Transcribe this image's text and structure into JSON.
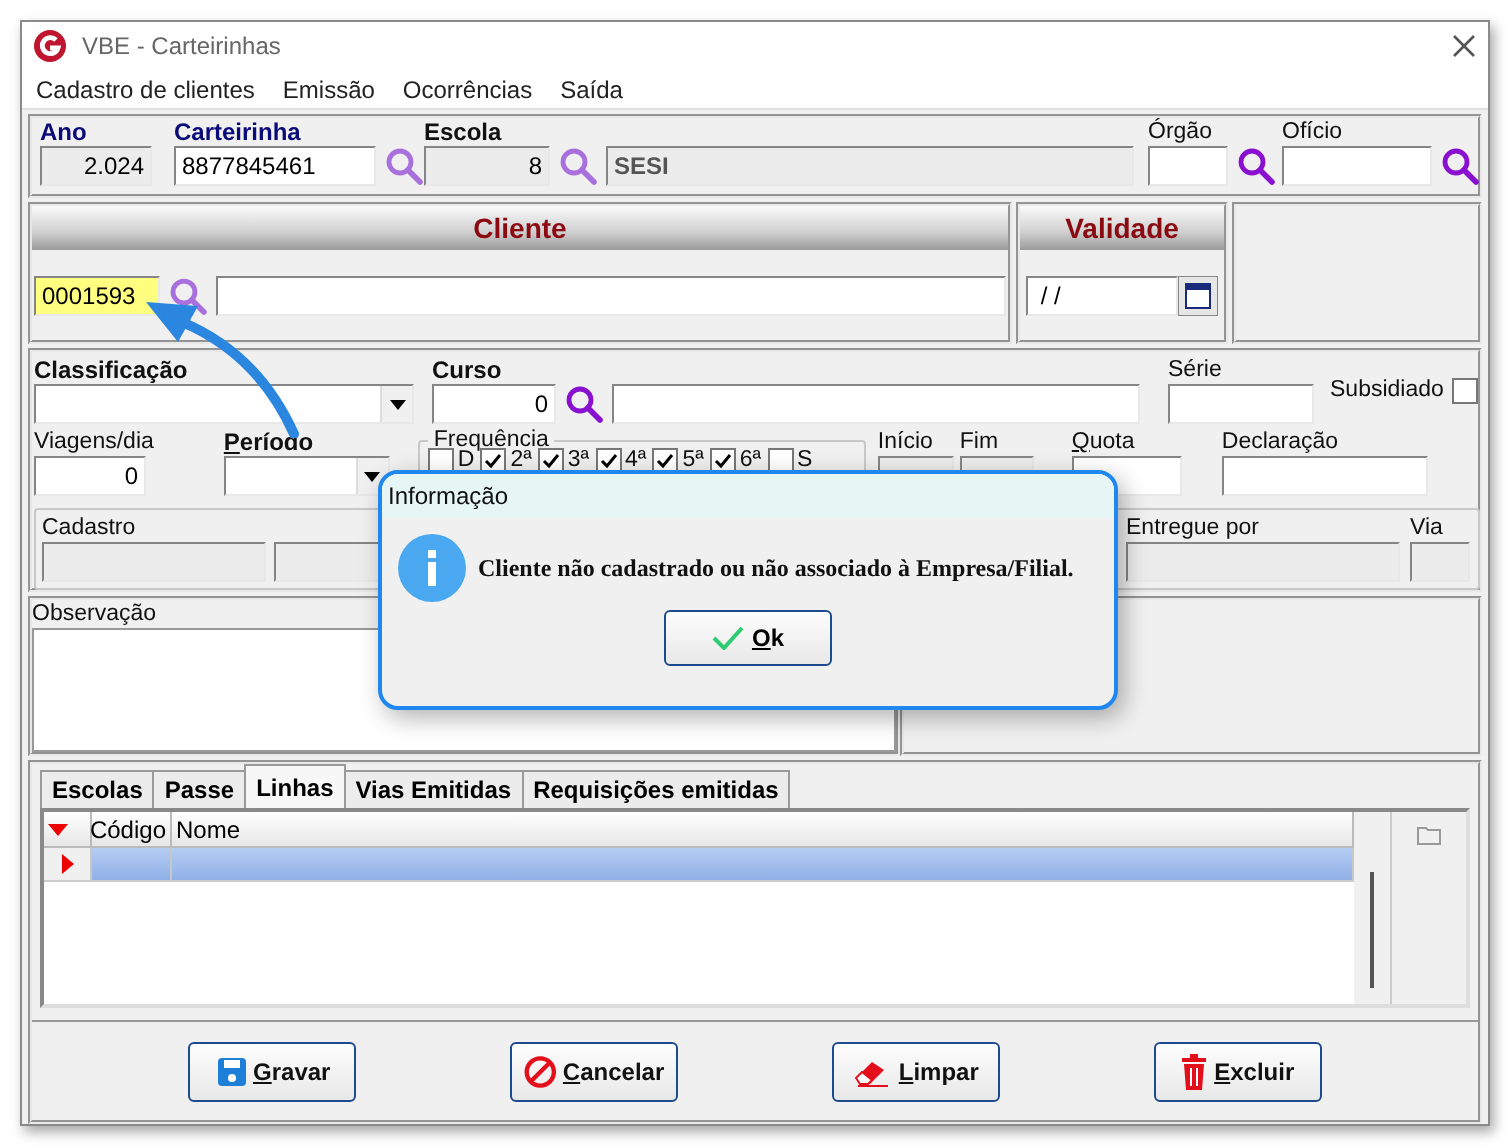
{
  "window": {
    "title": "VBE - Carteirinhas"
  },
  "menu": [
    "Cadastro de clientes",
    "Emissão",
    "Ocorrências",
    "Saída"
  ],
  "ano": {
    "label": "Ano",
    "value": "2.024"
  },
  "carteirinha": {
    "label": "Carteirinha",
    "value": "8877845461"
  },
  "escola": {
    "label": "Escola",
    "code": "8",
    "name": "SESI"
  },
  "orgao": {
    "label": "Órgão"
  },
  "oficio": {
    "label": "Ofício"
  },
  "cliente": {
    "title": "Cliente",
    "code": "0001593"
  },
  "validade": {
    "title": "Validade",
    "value": " / /"
  },
  "classificacao": {
    "label": "Classificação"
  },
  "curso": {
    "label": "Curso",
    "code": "0"
  },
  "serie": {
    "label": "Série"
  },
  "subsidiado": {
    "label": "Subsidiado",
    "checked": false
  },
  "viagens": {
    "label": "Viagens/dia",
    "value": "0"
  },
  "periodo": {
    "label": "Período"
  },
  "frequencia": {
    "label": "Frequência",
    "days": [
      {
        "label": "D",
        "checked": false
      },
      {
        "label": "2ª",
        "checked": true
      },
      {
        "label": "3ª",
        "checked": true
      },
      {
        "label": "4ª",
        "checked": true
      },
      {
        "label": "5ª",
        "checked": true
      },
      {
        "label": "6ª",
        "checked": true
      },
      {
        "label": "S",
        "checked": false
      }
    ]
  },
  "inicio": {
    "label": "Início"
  },
  "fim": {
    "label": "Fim"
  },
  "quota": {
    "label": "Quota"
  },
  "declaracao": {
    "label": "Declaração"
  },
  "cadastro": {
    "label": "Cadastro"
  },
  "entregue_por": {
    "label": "Entregue por"
  },
  "via": {
    "label": "Via"
  },
  "observacao": {
    "label": "Observação"
  },
  "tabs": [
    {
      "label": "Escolas",
      "selected": false
    },
    {
      "label": "Passe",
      "selected": false
    },
    {
      "label": "Linhas",
      "selected": true
    },
    {
      "label": "Vias Emitidas",
      "selected": false
    },
    {
      "label": "Requisições emitidas",
      "selected": false
    }
  ],
  "grid": {
    "columns": [
      "Código",
      "Nome"
    ],
    "rows": [
      {
        "selected": true
      }
    ]
  },
  "buttons": [
    {
      "label": "Gravar",
      "kind": "save"
    },
    {
      "label": "Cancelar",
      "kind": "cancel"
    },
    {
      "label": "Limpar",
      "kind": "clear"
    },
    {
      "label": "Excluir",
      "kind": "delete"
    }
  ],
  "dialog": {
    "title": "Informação",
    "message": "Cliente não cadastrado ou não associado à Empresa/Filial.",
    "button": "Ok"
  }
}
